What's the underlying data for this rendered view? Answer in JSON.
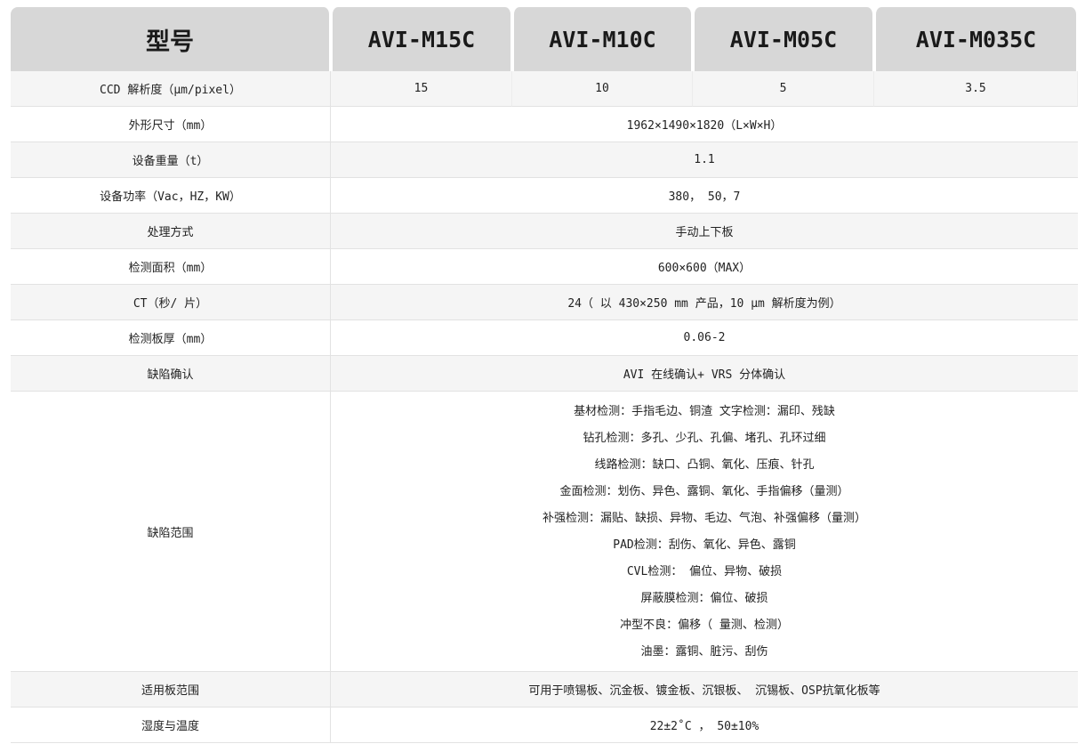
{
  "header": {
    "model_label": "型号",
    "models": [
      "AVI-M15C",
      "AVI-M10C",
      "AVI-M05C",
      "AVI-M035C"
    ]
  },
  "ccd_row": {
    "label": "CCD 解析度（μm/pixel）",
    "values": [
      "15",
      "10",
      "5",
      "3.5"
    ]
  },
  "rows": [
    {
      "label": "外形尺寸（mm）",
      "value": "1962×1490×1820（L×W×H）"
    },
    {
      "label": "设备重量（t）",
      "value": "1.1"
    },
    {
      "label": "设备功率（Vac，HZ，KW）",
      "value": "380， 50，7"
    },
    {
      "label": "处理方式",
      "value": "手动上下板"
    },
    {
      "label": "检测面积（mm）",
      "value": "600×600（MAX）"
    },
    {
      "label": "CT（秒/ 片）",
      "value": "24（ 以 430×250 mm 产品，10 μm 解析度为例）"
    },
    {
      "label": "检测板厚（mm）",
      "value": "0.06-2"
    },
    {
      "label": "缺陷确认",
      "value": "AVI 在线确认+ VRS 分体确认"
    }
  ],
  "defect_range": {
    "label": "缺陷范围",
    "items": [
      "基材检测：手指毛边、铜渣 文字检测：漏印、残缺",
      "钻孔检测：多孔、少孔、孔偏、堵孔、孔环过细",
      "线路检测：缺口、凸铜、氧化、压痕、针孔",
      "金面检测：划伤、异色、露铜、氧化、手指偏移（量测）",
      "补强检测：漏贴、缺损、异物、毛边、气泡、补强偏移（量测）",
      "PAD检测：刮伤、氧化、异色、露铜",
      "CVL检测： 偏位、异物、破损",
      "屏蔽膜检测：偏位、破损",
      "冲型不良：偏移（ 量测、检测）",
      "油墨：露铜、脏污、刮伤"
    ]
  },
  "tail_rows": [
    {
      "label": "适用板范围",
      "value": "可用于喷锡板、沉金板、镀金板、沉银板、 沉锡板、OSP抗氧化板等"
    },
    {
      "label": "湿度与温度",
      "value": "22±2˚C ， 50±10%"
    }
  ]
}
